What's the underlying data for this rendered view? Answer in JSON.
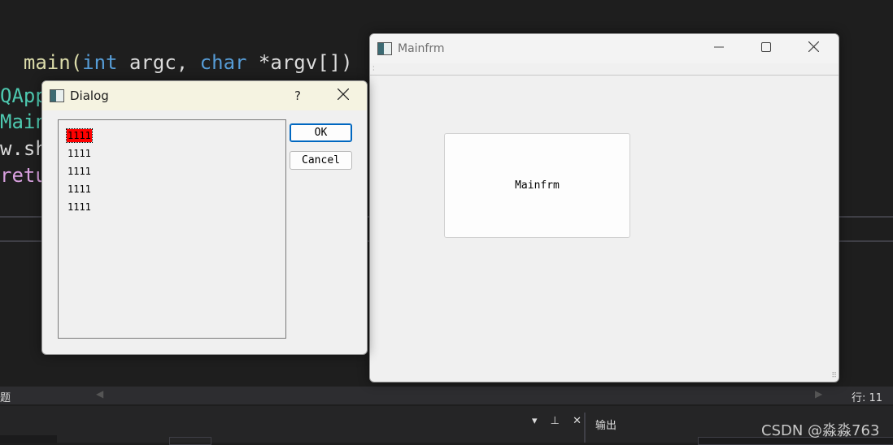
{
  "ide": {
    "code_lines": [
      [
        "main(",
        "int",
        " argc, ",
        "char",
        " *argv[])"
      ],
      [
        "QApp"
      ],
      [
        "Main"
      ],
      [
        "w.sho"
      ],
      [
        "retu"
      ]
    ],
    "issues_label": "题",
    "line_status": "行: 11",
    "output_label": "输出",
    "pane_tools": "▾ ⊥ ✕",
    "watermark": "CSDN @淼淼763"
  },
  "mainfrm": {
    "title": "Mainfrm",
    "minimize": "—",
    "maximize": "☐",
    "close": "✕",
    "center_button_label": "Mainfrm"
  },
  "dialog": {
    "title": "Dialog",
    "help": "?",
    "close": "✕",
    "list_items": [
      "1111",
      "1111",
      "1111",
      "1111",
      "1111"
    ],
    "selected_index": 0,
    "ok_label": "OK",
    "cancel_label": "Cancel"
  },
  "colors": {
    "selection": "#ff0000",
    "default_button_border": "#0067c0",
    "dialog_title_bg": "#f5f3e1"
  },
  "icons": [
    "app-window-icon",
    "minimize-icon",
    "maximize-icon",
    "close-icon",
    "help-icon",
    "pin-icon",
    "dropdown-icon",
    "resize-grip-icon"
  ]
}
